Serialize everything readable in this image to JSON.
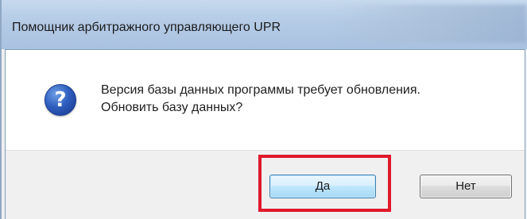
{
  "window": {
    "title": "Помощник арбитражного управляющего UPR"
  },
  "dialog": {
    "icon": "question-icon",
    "message_line1": "Версия базы данных программы требует обновления.",
    "message_line2": "Обновить базу данных?"
  },
  "buttons": {
    "yes_label": "Да",
    "no_label": "Нет"
  },
  "annotation": {
    "highlight_color": "#e0192b",
    "highlighted_button": "Да"
  }
}
